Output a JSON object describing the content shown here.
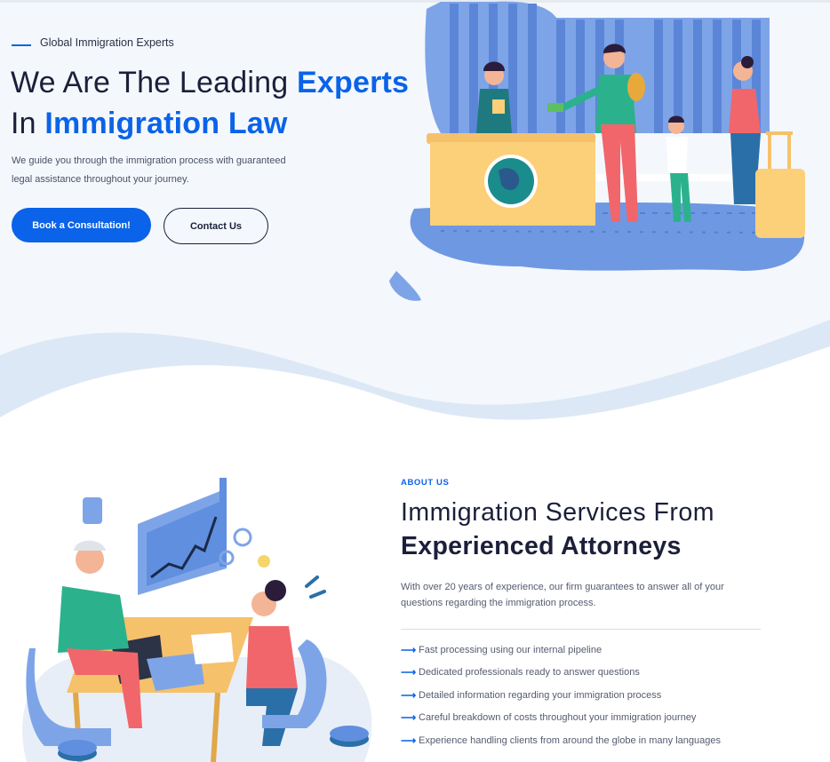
{
  "hero": {
    "eyebrow": "Global Immigration Experts",
    "title_part1": "We Are The Leading ",
    "title_accent1": "Experts",
    "title_part2": "In ",
    "title_accent2": "Immigration Law",
    "description": "We guide you through the immigration process with guaranteed legal assistance throughout your journey.",
    "primary_button": "Book a Consultation!",
    "secondary_button": "Contact Us"
  },
  "about": {
    "eyebrow": "ABOUT US",
    "title_line1": "Immigration Services From",
    "title_line2": "Experienced Attorneys",
    "description": "With over 20 years of experience, our firm guarantees to answer all of your questions regarding the immigration process.",
    "features": [
      "Fast processing using our internal pipeline",
      "Dedicated professionals ready to answer questions",
      "Detailed information regarding your immigration process",
      "Careful breakdown of costs throughout your immigration journey",
      "Experience handling clients from around the globe in many languages"
    ]
  },
  "colors": {
    "accent": "#0a63e8",
    "heading": "#1b1f3a",
    "hero_bg": "#f4f8fc"
  },
  "icons": {
    "feature_bullet": "arrow-right-icon"
  }
}
